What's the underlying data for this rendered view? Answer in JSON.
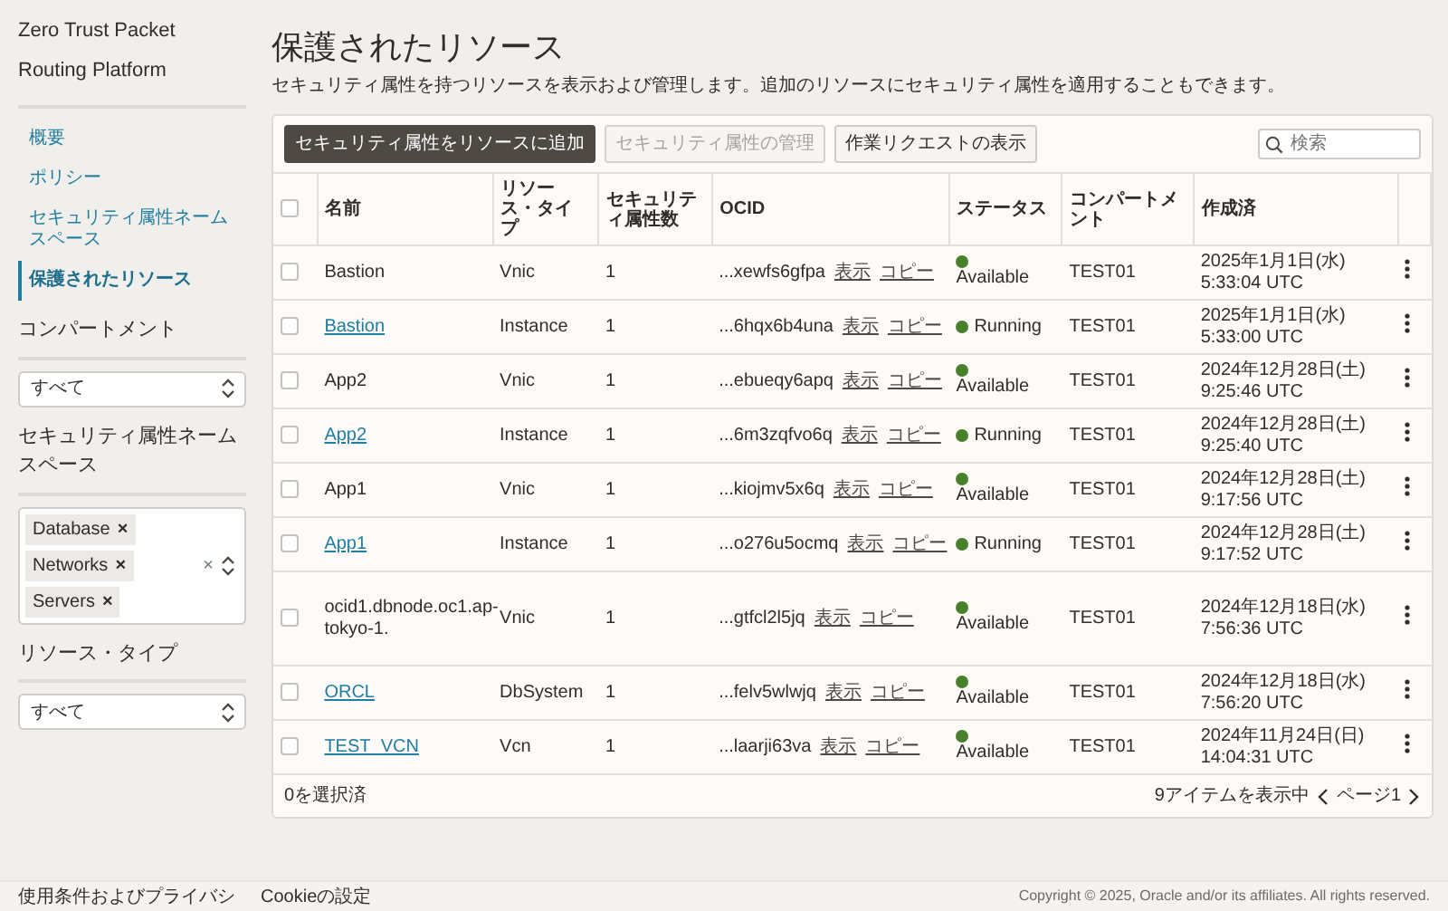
{
  "sidebar": {
    "title": "Zero Trust Packet Routing Platform",
    "nav": [
      {
        "label": "概要",
        "selected": false
      },
      {
        "label": "ポリシー",
        "selected": false
      },
      {
        "label": "セキュリティ属性ネームスペース",
        "selected": false
      },
      {
        "label": "保護されたリソース",
        "selected": true
      }
    ],
    "filters": [
      {
        "kind": "select",
        "label": "コンパートメント",
        "value": "すべて"
      },
      {
        "kind": "tags",
        "label": "セキュリティ属性ネームスペース",
        "tags": [
          {
            "label": "Database",
            "remove": "×"
          },
          {
            "label": "Networks",
            "remove": "×"
          },
          {
            "label": "Servers",
            "remove": "×"
          }
        ],
        "clear": "×"
      },
      {
        "kind": "select",
        "label": "リソース・タイプ",
        "value": "すべて"
      }
    ]
  },
  "main": {
    "title": "保護されたリソース",
    "description": "セキュリティ属性を持つリソースを表示および管理します。追加のリソースにセキュリティ属性を適用することもできます。",
    "buttons": [
      {
        "label": "セキュリティ属性をリソースに追加",
        "kind": "primary"
      },
      {
        "label": "セキュリティ属性の管理",
        "kind": "disabled"
      },
      {
        "label": "作業リクエストの表示",
        "kind": "default"
      }
    ],
    "search": {
      "placeholder": "検索"
    },
    "table": {
      "header_checked": false,
      "columns": [
        "名前",
        "リソース・タイプ",
        "セキュリティ属性数",
        "OCID",
        "ステータス",
        "コンパートメント",
        "作成済"
      ],
      "rows": [
        {
          "checked": false,
          "name": "Bastion",
          "link": false,
          "type": "Vnic",
          "count": "1",
          "ocid": "...xewfs6gfpa",
          "show": "表示",
          "copy": "コピー",
          "status": "Available",
          "compartment": "TEST01",
          "created": "2025年1月1日(水) 5:33:04 UTC"
        },
        {
          "checked": false,
          "name": "Bastion",
          "link": true,
          "type": "Instance",
          "count": "1",
          "ocid": "...6hqx6b4una",
          "show": "表示",
          "copy": "コピー",
          "status": "Running",
          "compartment": "TEST01",
          "created": "2025年1月1日(水) 5:33:00 UTC"
        },
        {
          "checked": false,
          "name": "App2",
          "link": false,
          "type": "Vnic",
          "count": "1",
          "ocid": "...ebueqy6apq",
          "show": "表示",
          "copy": "コピー",
          "status": "Available",
          "compartment": "TEST01",
          "created": "2024年12月28日(土) 9:25:46 UTC"
        },
        {
          "checked": false,
          "name": "App2",
          "link": true,
          "type": "Instance",
          "count": "1",
          "ocid": "...6m3zqfvo6q",
          "show": "表示",
          "copy": "コピー",
          "status": "Running",
          "compartment": "TEST01",
          "created": "2024年12月28日(土) 9:25:40 UTC"
        },
        {
          "checked": false,
          "name": "App1",
          "link": false,
          "type": "Vnic",
          "count": "1",
          "ocid": "...kiojmv5x6q",
          "show": "表示",
          "copy": "コピー",
          "status": "Available",
          "compartment": "TEST01",
          "created": "2024年12月28日(土) 9:17:56 UTC"
        },
        {
          "checked": false,
          "name": "App1",
          "link": true,
          "type": "Instance",
          "count": "1",
          "ocid": "...o276u5ocmq",
          "show": "表示",
          "copy": "コピー",
          "status": "Running",
          "compartment": "TEST01",
          "created": "2024年12月28日(土) 9:17:52 UTC"
        },
        {
          "checked": false,
          "name": "ocid1.dbnode.oc1.ap-tokyo-1.",
          "link": false,
          "type": "Vnic",
          "count": "1",
          "ocid": "...gtfcl2l5jq",
          "show": "表示",
          "copy": "コピー",
          "status": "Available",
          "compartment": "TEST01",
          "created": "2024年12月18日(水) 7:56:36 UTC"
        },
        {
          "checked": false,
          "name": "ORCL",
          "link": true,
          "type": "DbSystem",
          "count": "1",
          "ocid": "...felv5wlwjq",
          "show": "表示",
          "copy": "コピー",
          "status": "Available",
          "compartment": "TEST01",
          "created": "2024年12月18日(水) 7:56:20 UTC"
        },
        {
          "checked": false,
          "name": "TEST_VCN",
          "link": true,
          "type": "Vcn",
          "count": "1",
          "ocid": "...laarji63va",
          "show": "表示",
          "copy": "コピー",
          "status": "Available",
          "compartment": "TEST01",
          "created": "2024年11月24日(日) 14:04:31 UTC"
        }
      ]
    },
    "footer": {
      "selected": "0を選択済",
      "count": "9アイテムを表示中",
      "page": "ページ1"
    }
  },
  "page_footer": {
    "links": [
      "使用条件およびプライバシ",
      "Cookieの設定"
    ],
    "copyright": "Copyright © 2025, Oracle and/or its affiliates. All rights reserved."
  }
}
